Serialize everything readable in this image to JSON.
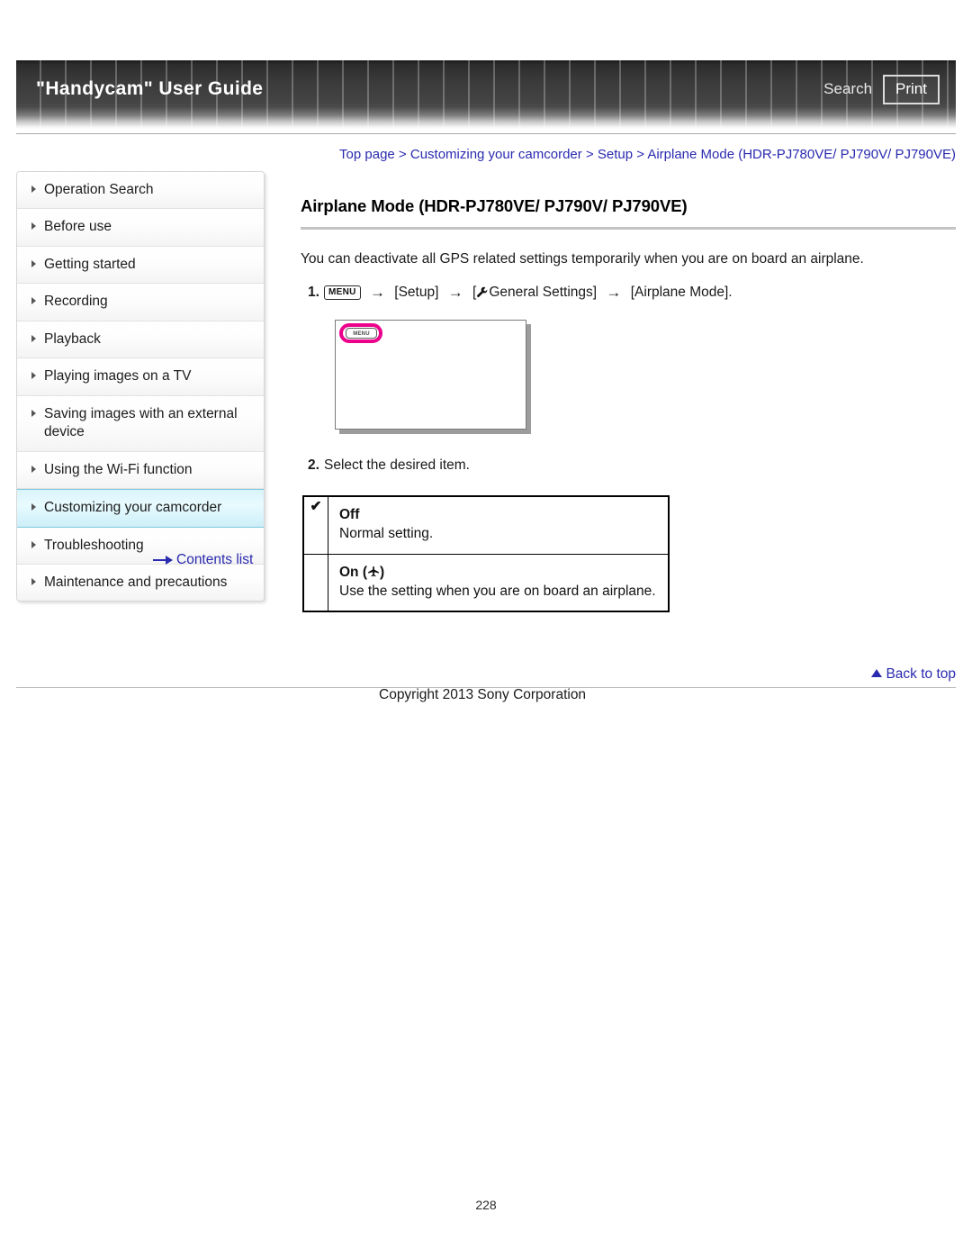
{
  "header": {
    "title": "\"Handycam\" User Guide",
    "search_label": "Search",
    "print_label": "Print"
  },
  "breadcrumb": {
    "full": "Top page > Customizing your camcorder > Setup > Airplane Mode (HDR-PJ780VE/ PJ790V/ PJ790VE)"
  },
  "sidebar": {
    "items": [
      {
        "label": "Operation Search",
        "active": false
      },
      {
        "label": "Before use",
        "active": false
      },
      {
        "label": "Getting started",
        "active": false
      },
      {
        "label": "Recording",
        "active": false
      },
      {
        "label": "Playback",
        "active": false
      },
      {
        "label": "Playing images on a TV",
        "active": false
      },
      {
        "label": "Saving images with an external device",
        "active": false
      },
      {
        "label": "Using the Wi-Fi function",
        "active": false
      },
      {
        "label": "Customizing your camcorder",
        "active": true
      },
      {
        "label": "Troubleshooting",
        "active": false
      },
      {
        "label": "Maintenance and precautions",
        "active": false
      }
    ],
    "contents_link": "Contents list"
  },
  "main": {
    "title": "Airplane Mode (HDR-PJ780VE/ PJ790V/ PJ790VE)",
    "intro": "You can deactivate all GPS related settings temporarily when you are on board an airplane.",
    "step1": {
      "number": "1.",
      "menu_chip": "MENU",
      "arrow": "→",
      "part1": "[Setup]",
      "bracket_open": "[",
      "general_settings": "General Settings]",
      "part3": "[Airplane Mode]."
    },
    "lcd": {
      "menu_button_label": "MENU"
    },
    "step2": {
      "number": "2.",
      "text": "Select the desired item."
    },
    "options": [
      {
        "check": "✔",
        "name": "Off",
        "desc": "Normal setting."
      },
      {
        "check": "",
        "name": "On (",
        "name_suffix": ")",
        "desc": "Use the setting when you are on board an airplane."
      }
    ]
  },
  "footer": {
    "back_to_top": "Back to top",
    "copyright": "Copyright 2013 Sony Corporation",
    "page_number": "228"
  },
  "colors": {
    "link": "#2a2ab0",
    "highlight_pink": "#ec008c",
    "active_nav": "#d9f4fb"
  }
}
